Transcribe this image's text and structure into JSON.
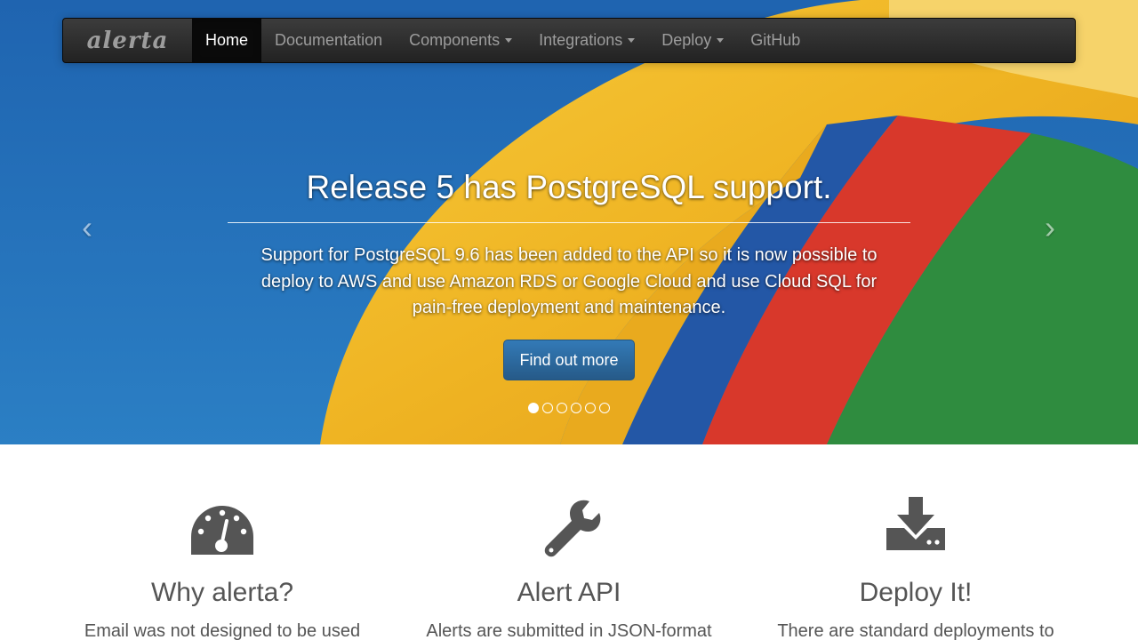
{
  "brand": "alerta",
  "nav": {
    "items": [
      {
        "label": "Home",
        "active": true
      },
      {
        "label": "Documentation"
      },
      {
        "label": "Components",
        "dropdown": true
      },
      {
        "label": "Integrations",
        "dropdown": true
      },
      {
        "label": "Deploy",
        "dropdown": true
      },
      {
        "label": "GitHub"
      }
    ]
  },
  "carousel": {
    "heading": "Release 5 has PostgreSQL support.",
    "text": "Support for PostgreSQL 9.6 has been added to the API so it is now possible to deploy to AWS and use Amazon RDS or Google Cloud and use Cloud SQL for pain-free deployment and maintenance.",
    "button": "Find out more",
    "slide_count": 6,
    "active_slide": 1,
    "prev_icon": "chevron-left-icon",
    "next_icon": "chevron-right-icon"
  },
  "features": [
    {
      "icon": "dashboard-icon",
      "title": "Why alerta?",
      "text": "Email was not designed to be used"
    },
    {
      "icon": "wrench-icon",
      "title": "Alert API",
      "text": "Alerts are submitted in JSON-format"
    },
    {
      "icon": "download-icon",
      "title": "Deploy It!",
      "text": "There are standard deployments to"
    }
  ],
  "colors": {
    "navbar": "#222222",
    "primary_button": "#337ab7",
    "feature_text": "#555555"
  }
}
